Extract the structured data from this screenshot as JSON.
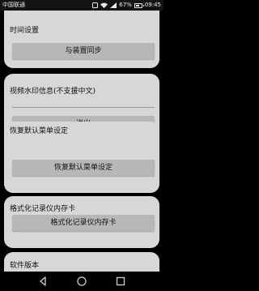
{
  "status_bar": {
    "carrier": "中国联通",
    "battery": "67%",
    "battery_level": 0.67,
    "time": "09:45"
  },
  "cards": {
    "time_settings": {
      "title": "时间设置",
      "button": "与装置同步"
    },
    "watermark": {
      "title": "视频水印信息(不支援中文)",
      "input_value": "",
      "button": "送出"
    },
    "restore_menu": {
      "title": "恢复默认菜单设定",
      "button": "恢复默认菜单设定"
    },
    "format_card": {
      "title": "格式化记录仪内存卡",
      "button": "格式化记录仪内存卡"
    },
    "software_version": {
      "title": "软件版本"
    }
  },
  "nav_bar": {
    "icons": [
      "back-icon",
      "home-icon",
      "recents-icon"
    ]
  },
  "colors": {
    "background": "#000000",
    "card": "#d7d7d7",
    "button": "#b7b7b7"
  }
}
